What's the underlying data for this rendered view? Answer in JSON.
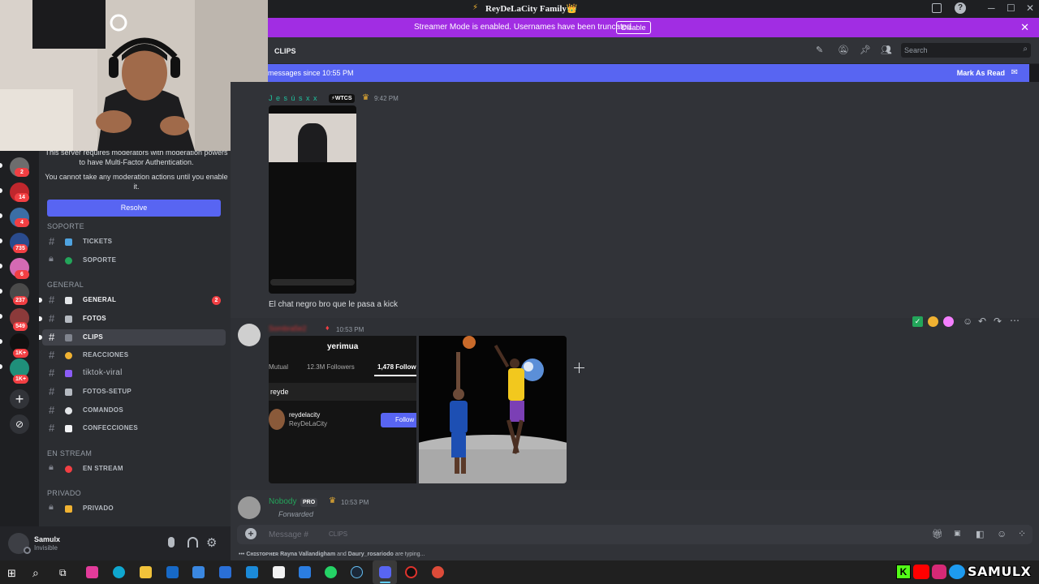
{
  "window": {
    "title": "ReyDeLaCity Family👑",
    "min_glyph": "─",
    "max_glyph": "☐",
    "close_glyph": "✕"
  },
  "banner": {
    "text": "Streamer Mode is enabled. Usernames have been truncated.",
    "button": "Disable",
    "close": "✕"
  },
  "servers": [
    {
      "badge": "2",
      "color": "#6d6d6d"
    },
    {
      "badge": "14",
      "color": "#c0272d"
    },
    {
      "badge": "4",
      "color": "#3b6ea5"
    },
    {
      "badge": "735",
      "color": "#2a4b8d"
    },
    {
      "badge": "6",
      "color": "#d46ab3"
    },
    {
      "badge": "237",
      "color": "#4a4a4a"
    },
    {
      "badge": "549",
      "color": "#8b3a3a"
    },
    {
      "badge": "1K+",
      "color": "#111111"
    },
    {
      "badge": "1K+",
      "color": "#1f8f7a"
    }
  ],
  "sidebar": {
    "notice_top": "This server requires moderators with moderation powers to have Multi-Factor Authentication.",
    "notice_bottom": "You cannot take any moderation actions until you enable it.",
    "resolve": "Resolve",
    "categories": {
      "soporte": "SOPORTE",
      "general": "GENERAL",
      "enstream": "EN STREAM",
      "privado": "PRIVADO"
    },
    "channels": {
      "tickets": "TICKETS",
      "soporte": "SOPORTE",
      "general": "GENERAL",
      "general_badge": "2",
      "fotos": "FOTOS",
      "clips": "CLIPS",
      "reacciones": "REACCIONES",
      "tiktok": "tiktok-viral",
      "fotos_setup": "FOTOS-SETUP",
      "comandos": "COMANDOS",
      "confecciones": "CONFECCIONES",
      "enstream": "EN STREAM",
      "privado": "PRIVADO"
    }
  },
  "user": {
    "name": "Samulx",
    "status": "Invisible"
  },
  "header": {
    "channel": "CLIPS",
    "search_placeholder": "Search"
  },
  "newbar": {
    "text": "messages since 10:55 PM",
    "mark": "Mark As Read"
  },
  "messages": [
    {
      "author": "J e s ú s  x x",
      "tag": "⚡WTCS",
      "time": "9:42 PM",
      "text": "El chat negro bro que le pasa a kick"
    },
    {
      "author": "Sombra5e2",
      "time": "10:53 PM",
      "embed": {
        "title": "yerimua",
        "stat1": "Mutual",
        "stat2": "12.3M Followers",
        "stat3": "1,478 Follow",
        "search": "reyde",
        "result_name": "reydelacity",
        "result_sub": "ReyDeLaCity",
        "follow": "Follow"
      }
    },
    {
      "author": "Nobody",
      "tag": "PRO",
      "time": "10:53 PM",
      "forwarded": "Forwarded"
    }
  ],
  "composer": {
    "placeholder": "Message #",
    "channel": "CLIPS",
    "typing_names": "Cʜɪsтoᴘʜᴇʀ Rayna Vallandigham",
    "typing_and": "and",
    "typing_second": "Daury_rosariodo",
    "typing_suffix": "are typing..."
  },
  "overlay": {
    "handle": "SAMULX"
  }
}
